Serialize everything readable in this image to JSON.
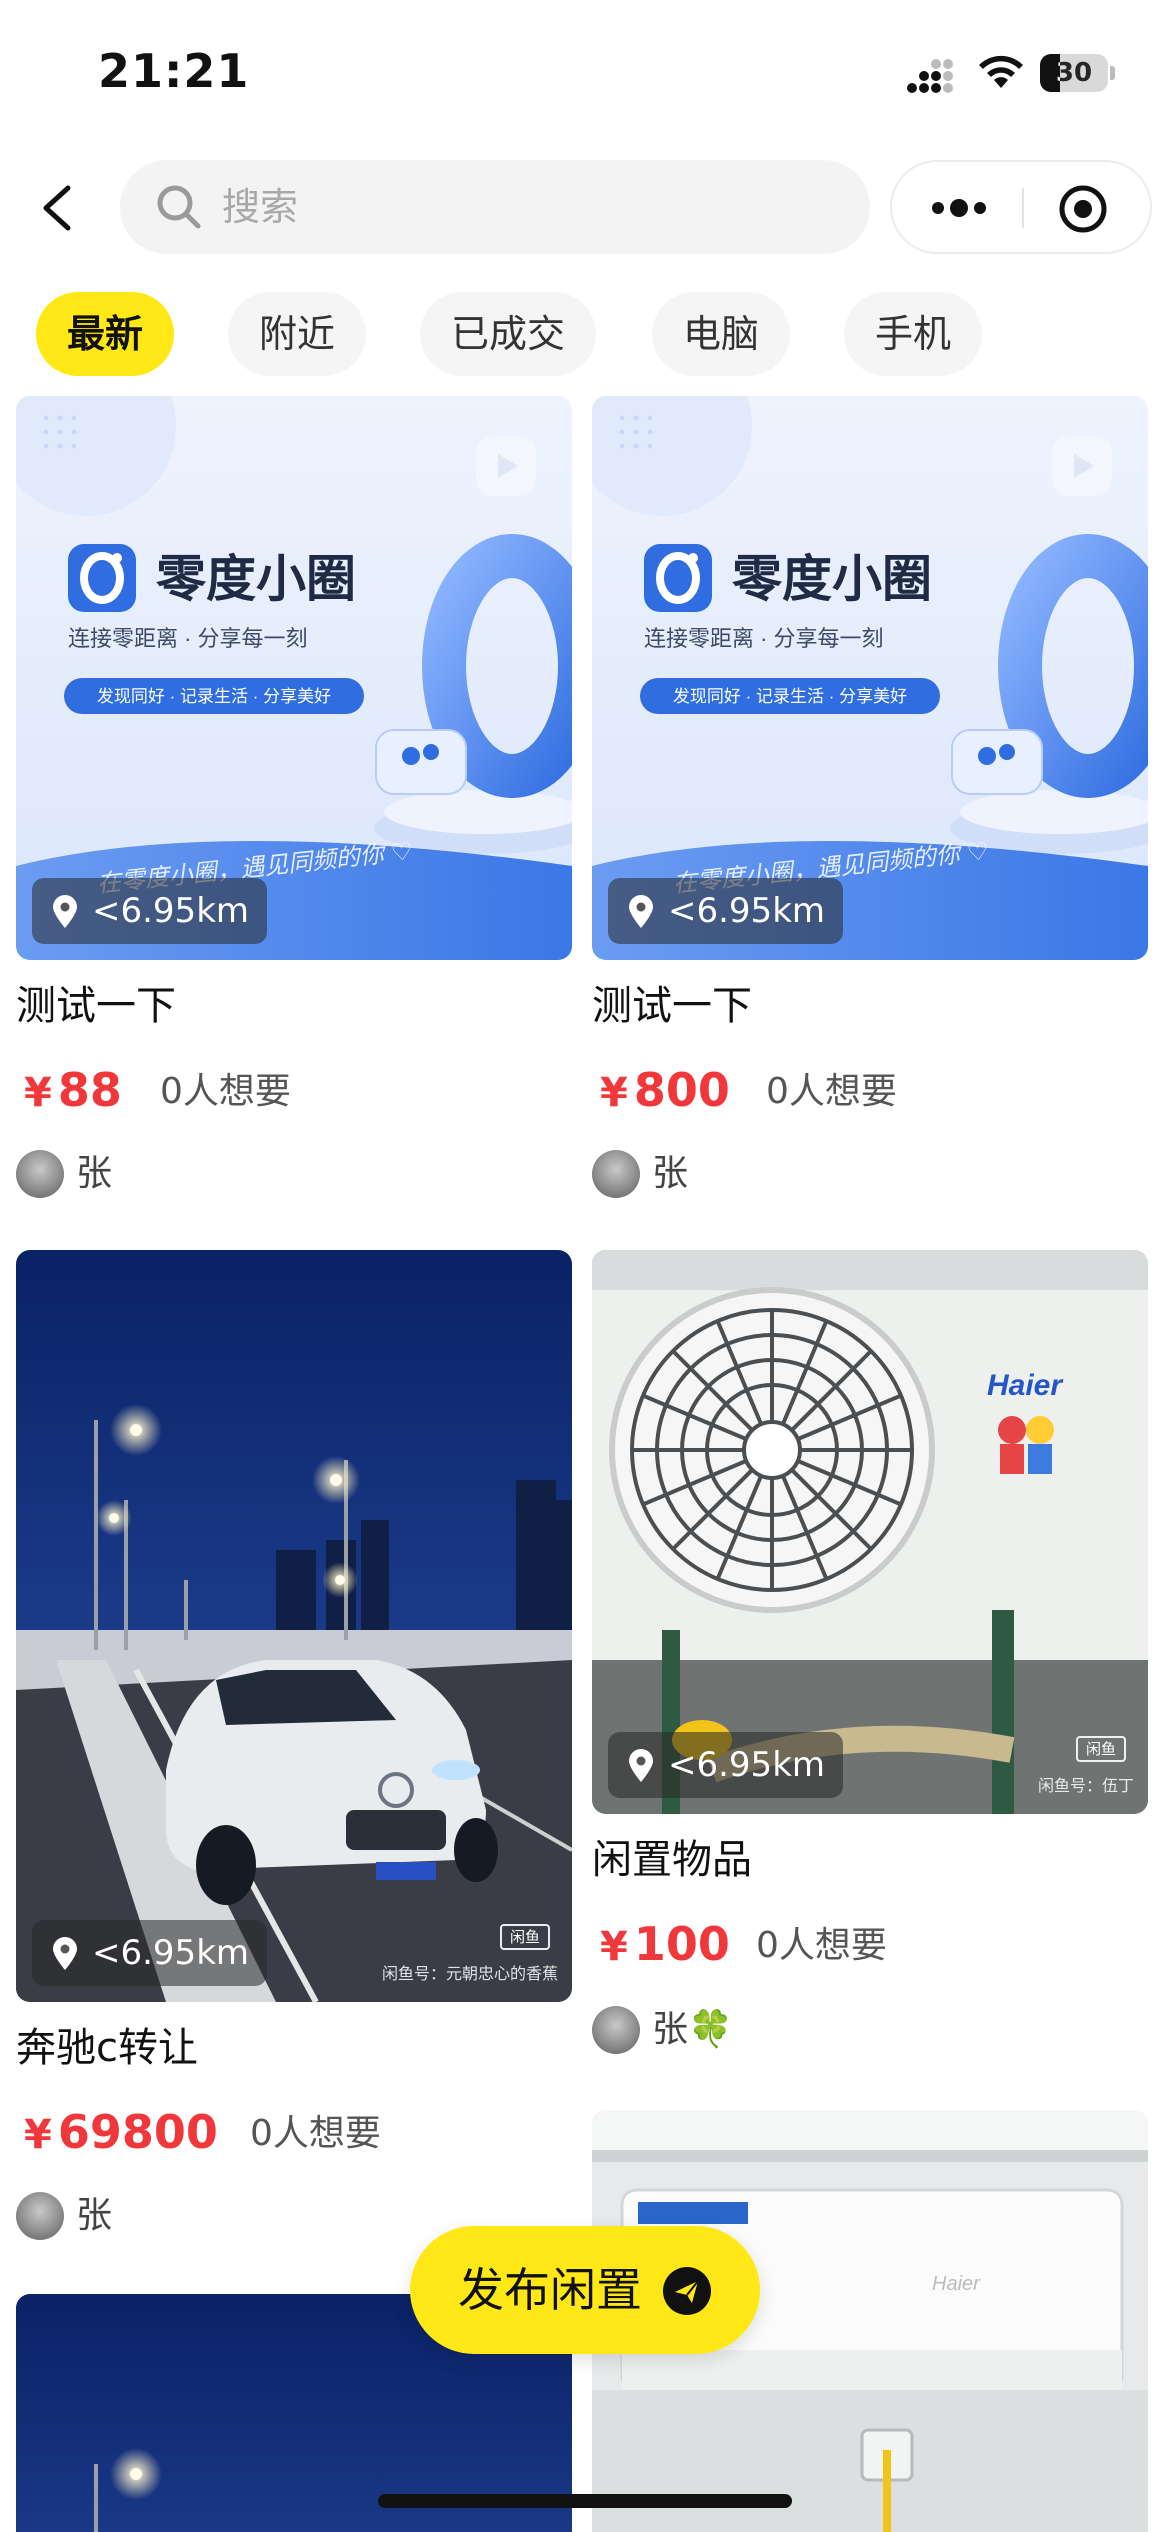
{
  "status_bar": {
    "time": "21:21",
    "battery": "30",
    "battery_level": 0.3
  },
  "search": {
    "placeholder": "搜索"
  },
  "tabs": [
    {
      "label": "最新",
      "active": true
    },
    {
      "label": "附近",
      "active": false
    },
    {
      "label": "已成交",
      "active": false
    },
    {
      "label": "电脑",
      "active": false
    },
    {
      "label": "手机",
      "active": false
    }
  ],
  "promo": {
    "brand": "零度小圈",
    "tagline": "连接零距离 · 分享每一刻",
    "pill": "发现同好 · 记录生活 · 分享美好",
    "handwriting": "在零度小圈，遇见同频的你 ♡"
  },
  "products": [
    {
      "distance": "<6.95km",
      "title": "测试一下",
      "currency": "¥",
      "price": "88",
      "wants": "0人想要",
      "seller": "张"
    },
    {
      "distance": "<6.95km",
      "title": "测试一下",
      "currency": "¥",
      "price": "800",
      "wants": "0人想要",
      "seller": "张"
    },
    {
      "distance": "<6.95km",
      "title": "奔驰c转让",
      "currency": "¥",
      "price": "69800",
      "wants": "0人想要",
      "seller": "张",
      "watermark_logo": "闲鱼",
      "watermark": "闲鱼号：元朝忠心的香蕉"
    },
    {
      "distance": "<6.95km",
      "title": "闲置物品",
      "currency": "¥",
      "price": "100",
      "wants": "0人想要",
      "seller": "张🍀",
      "watermark_logo": "闲鱼",
      "watermark": "闲鱼号：伍丁",
      "brand_mark": "Haier"
    },
    {
      "brand_mark": "Haier"
    }
  ],
  "publish_button": {
    "label": "发布闲置"
  },
  "colors": {
    "accent_yellow": "#ffe815",
    "price_red": "#f0373b",
    "promo_blue": "#3a7ae8"
  }
}
